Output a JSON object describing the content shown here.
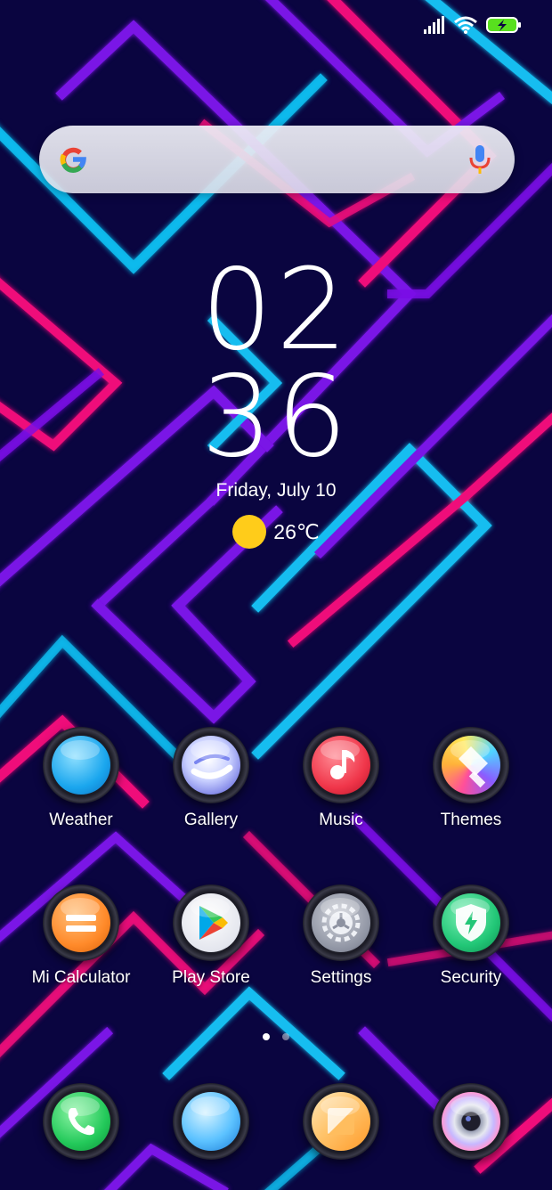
{
  "status_bar": {
    "signal_icon": "signal-bars-icon",
    "wifi_icon": "wifi-icon",
    "battery_icon": "battery-charging-icon"
  },
  "search": {
    "placeholder": "",
    "logo_icon": "google-g-icon",
    "mic_icon": "microphone-icon"
  },
  "clock": {
    "hours": "02",
    "minutes": "36"
  },
  "date": "Friday, July 10",
  "weather": {
    "icon": "sun-icon",
    "temperature": "26℃"
  },
  "apps": [
    {
      "label": "Weather",
      "icon": "weather-icon"
    },
    {
      "label": "Gallery",
      "icon": "gallery-icon"
    },
    {
      "label": "Music",
      "icon": "music-icon"
    },
    {
      "label": "Themes",
      "icon": "themes-icon"
    },
    {
      "label": "Mi Calculator",
      "icon": "calculator-icon"
    },
    {
      "label": "Play Store",
      "icon": "play-store-icon"
    },
    {
      "label": "Settings",
      "icon": "settings-gear-icon"
    },
    {
      "label": "Security",
      "icon": "security-shield-icon"
    }
  ],
  "page_indicator": {
    "pages": 2,
    "current": 1
  },
  "dock": [
    {
      "icon": "phone-icon"
    },
    {
      "icon": "messages-icon"
    },
    {
      "icon": "browser-icon"
    },
    {
      "icon": "camera-icon"
    }
  ],
  "colors": {
    "background": "#0a0540",
    "neon_purple": "#7a12e6",
    "neon_pink": "#ef0f7a",
    "neon_cyan": "#12bdf0",
    "sun": "#ffcc1a",
    "battery": "#58e01e"
  }
}
